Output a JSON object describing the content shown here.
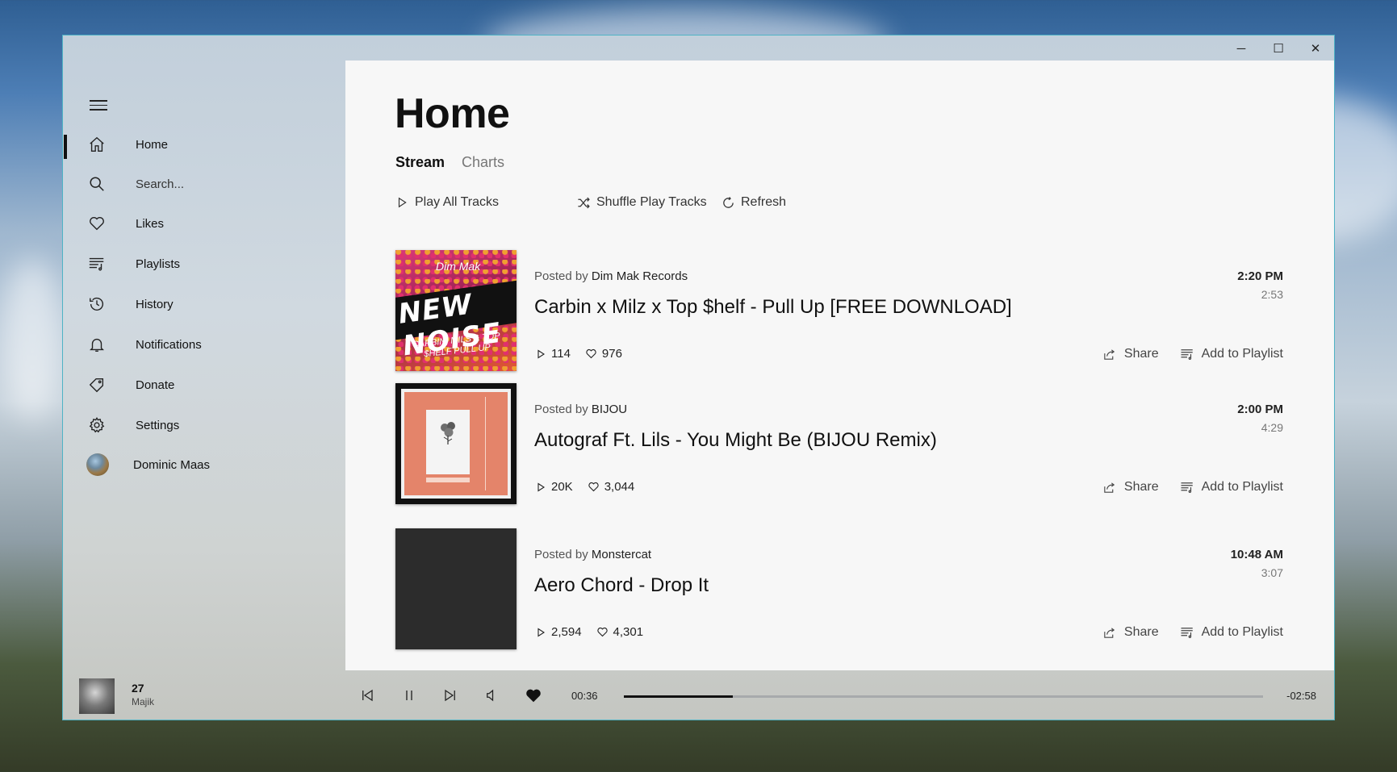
{
  "window": {
    "controls": {
      "minimize": "─",
      "maximize": "☐",
      "close": "✕"
    }
  },
  "sidebar": {
    "items": [
      {
        "key": "home",
        "label": "Home",
        "icon": "home-icon",
        "active": true
      },
      {
        "key": "search",
        "label": "Search...",
        "icon": "search-icon"
      },
      {
        "key": "likes",
        "label": "Likes",
        "icon": "heart-icon"
      },
      {
        "key": "playlists",
        "label": "Playlists",
        "icon": "playlist-icon"
      },
      {
        "key": "history",
        "label": "History",
        "icon": "history-icon"
      },
      {
        "key": "notifications",
        "label": "Notifications",
        "icon": "bell-icon"
      },
      {
        "key": "donate",
        "label": "Donate",
        "icon": "tag-icon"
      },
      {
        "key": "settings",
        "label": "Settings",
        "icon": "gear-icon"
      }
    ],
    "user": {
      "name": "Dominic Maas"
    }
  },
  "page": {
    "title": "Home",
    "tabs": [
      {
        "label": "Stream",
        "active": true
      },
      {
        "label": "Charts",
        "active": false
      }
    ],
    "actions": {
      "play_all": "Play All Tracks",
      "shuffle": "Shuffle Play Tracks",
      "refresh": "Refresh"
    }
  },
  "tracks": [
    {
      "posted_prefix": "Posted by",
      "poster": "Dim Mak Records",
      "title": "Carbin x Milz x Top $helf - Pull Up [FREE DOWNLOAD]",
      "time": "2:20 PM",
      "duration": "2:53",
      "plays": "114",
      "likes": "976",
      "share": "Share",
      "add": "Add to Playlist",
      "art": {
        "label": "Dim Mak",
        "headline": "NEW NOISE",
        "caption": "CARBIN, MILS & TOP $HELF PULL UP"
      }
    },
    {
      "posted_prefix": "Posted by",
      "poster": "BIJOU",
      "title": "Autograf Ft. Lils - You Might Be (BIJOU Remix)",
      "time": "2:00 PM",
      "duration": "4:29",
      "plays": "20K",
      "likes": "3,044",
      "share": "Share",
      "add": "Add to Playlist"
    },
    {
      "posted_prefix": "Posted by",
      "poster": "Monstercat",
      "title": "Aero Chord - Drop It",
      "time": "10:48 AM",
      "duration": "3:07",
      "plays": "2,594",
      "likes": "4,301",
      "share": "Share",
      "add": "Add to Playlist"
    }
  ],
  "player": {
    "title": "27",
    "artist": "Majik",
    "elapsed": "00:36",
    "remaining": "-02:58",
    "progress_fraction": 0.17,
    "liked": true
  }
}
